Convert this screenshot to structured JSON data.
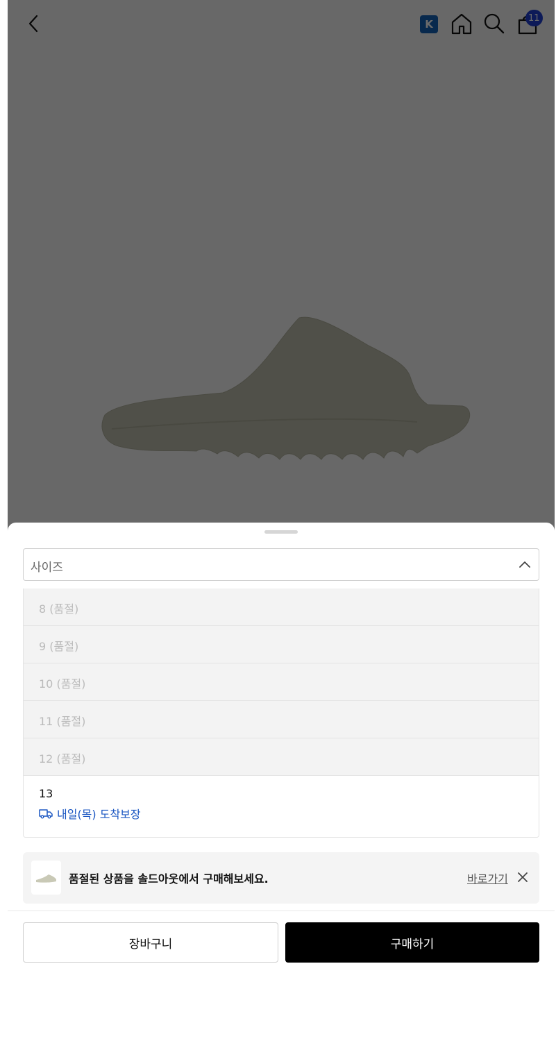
{
  "header": {
    "k_badge": "K",
    "cart_count": "11"
  },
  "icons": {
    "back": "chevron-left-icon",
    "home": "home-icon",
    "search": "search-icon",
    "cart": "shopping-bag-icon",
    "dropdown": "chevron-up-icon",
    "delivery": "truck-icon",
    "close": "close-icon"
  },
  "size_select": {
    "label": "사이즈",
    "options": [
      {
        "label": "8 (품절)",
        "sold_out": true
      },
      {
        "label": "9 (품절)",
        "sold_out": true
      },
      {
        "label": "10 (품절)",
        "sold_out": true
      },
      {
        "label": "11 (품절)",
        "sold_out": true
      },
      {
        "label": "12 (품절)",
        "sold_out": true
      },
      {
        "label": "13",
        "sold_out": false,
        "delivery": "내일(목) 도착보장"
      }
    ]
  },
  "soldout_banner": {
    "message": "품절된 상품을 솔드아웃에서 구매해보세요.",
    "link": "바로가기"
  },
  "actions": {
    "cart_label": "장바구니",
    "buy_label": "구매하기"
  },
  "colors": {
    "accent_blue": "#1a56c2",
    "badge_blue": "#1462b8",
    "cart_count_bg": "#1f3fd1",
    "buy_button": "#000000"
  }
}
